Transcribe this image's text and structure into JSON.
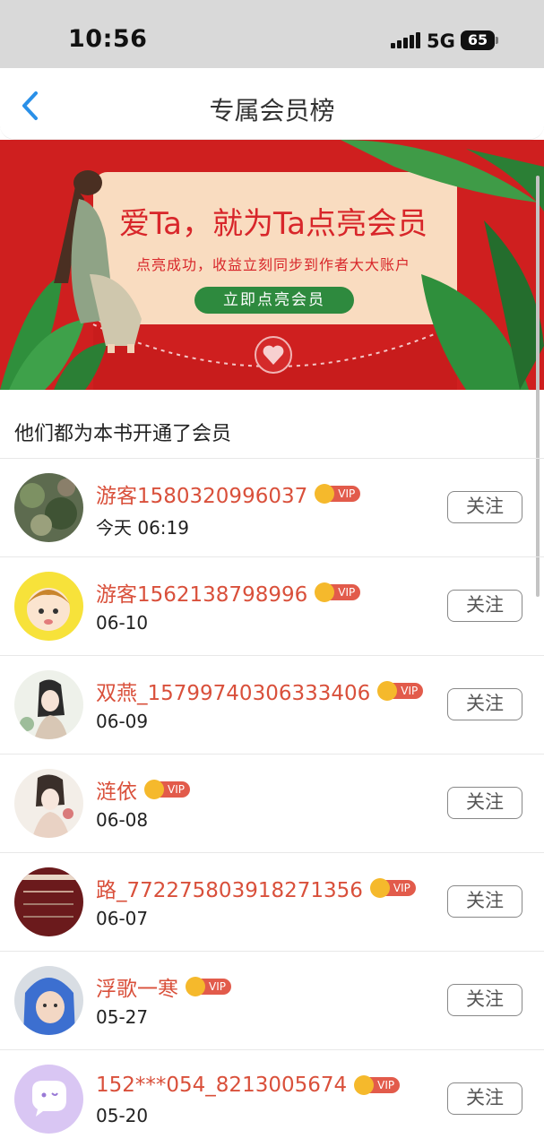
{
  "status_bar": {
    "time": "10:56",
    "network": "5G",
    "battery": "65"
  },
  "nav": {
    "title": "专属会员榜",
    "back_icon": "chevron-left-icon"
  },
  "banner": {
    "headline": "爱Ta，就为Ta点亮会员",
    "subtitle": "点亮成功，收益立刻同步到作者大大账户",
    "cta": "立即点亮会员"
  },
  "section_title": "他们都为本书开通了会员",
  "colors": {
    "accent_red": "#d9503b",
    "banner_red": "#cf1f1f",
    "cta_green": "#2e8a3e",
    "vip_badge": "#e25b4b"
  },
  "members": [
    {
      "name": "游客1580320996037",
      "date": "今天 06:19",
      "badge": "VIP",
      "follow": "关注",
      "avatar": "plant-photo"
    },
    {
      "name": "游客1562138798996",
      "date": "06-10",
      "badge": "VIP",
      "follow": "关注",
      "avatar": "cartoon-face"
    },
    {
      "name": "双燕_15799740306333406",
      "date": "06-09",
      "badge": "VIP",
      "follow": "关注",
      "avatar": "painted-lady"
    },
    {
      "name": "涟依",
      "date": "06-08",
      "badge": "VIP",
      "follow": "关注",
      "avatar": "painted-lady-2"
    },
    {
      "name": "路_772275803918271356",
      "date": "06-07",
      "badge": "VIP",
      "follow": "关注",
      "avatar": "dark-red-poster"
    },
    {
      "name": "浮歌一寒",
      "date": "05-27",
      "badge": "VIP",
      "follow": "关注",
      "avatar": "child-photo"
    },
    {
      "name": "152***054_8213005674",
      "date": "05-20",
      "badge": "VIP",
      "follow": "关注",
      "avatar": "chat-bubble-icon"
    }
  ]
}
